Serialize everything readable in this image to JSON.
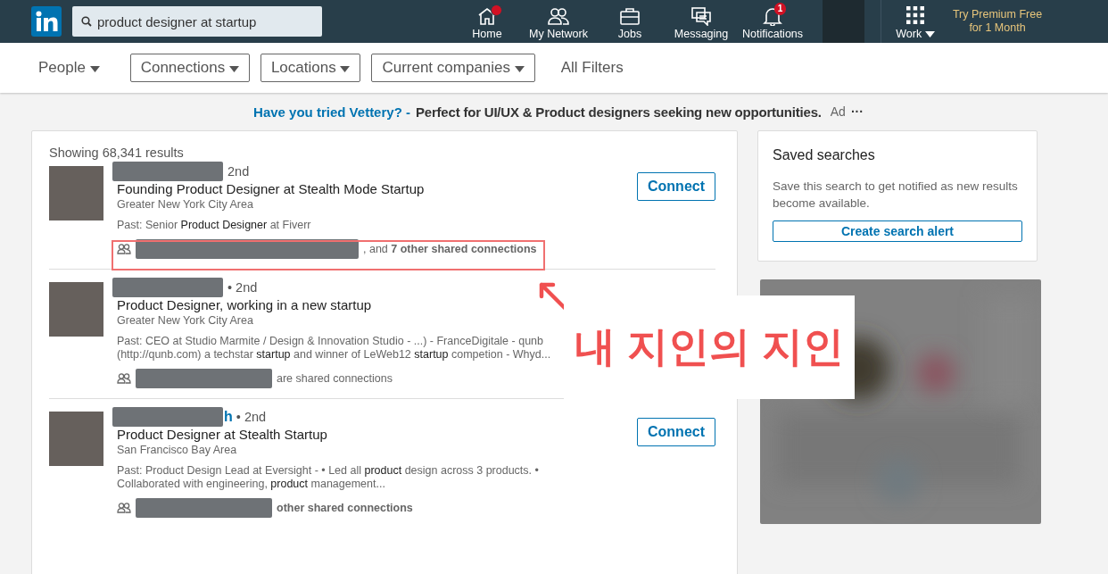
{
  "search": {
    "value": "product designer at startup"
  },
  "nav": [
    {
      "kind": "home",
      "label": "Home",
      "new_dot": true
    },
    {
      "kind": "network",
      "label": "My Network"
    },
    {
      "kind": "jobs",
      "label": "Jobs"
    },
    {
      "kind": "messaging",
      "label": "Messaging"
    },
    {
      "kind": "notifications",
      "label": "Notifications",
      "badge": "1"
    }
  ],
  "work": {
    "label": "Work"
  },
  "premium": {
    "line_1": "Try Premium Free",
    "line_2": "for 1 Month"
  },
  "filters": [
    {
      "kind": "plain",
      "label": "People"
    },
    {
      "kind": "outlined",
      "label": "Connections"
    },
    {
      "kind": "outlined",
      "label": "Locations"
    },
    {
      "kind": "outlined",
      "label": "Current companies"
    },
    {
      "kind": "link",
      "label": "All Filters"
    }
  ],
  "ad": {
    "link": "Have you tried Vettery? -",
    "text": "Perfect for UI/UX & Product designers seeking new opportunities.",
    "tag": "Ad",
    "more": "···"
  },
  "results": {
    "count": "Showing 68,341 results",
    "rows": [
      {
        "degree": "2nd",
        "headline": "Founding Product Designer at Stealth Mode Startup",
        "location": "Greater New York City Area",
        "snippet": "Past: Senior **Product Designer** at Fiverr",
        "shared": ", and **7 other shared connections**",
        "action": "Connect"
      },
      {
        "degree": "• 2nd",
        "headline": "Product Designer, working in a new startup",
        "location": "Greater New York City Area",
        "snippet": "Past: CEO at Studio Marmite / Design & Innovation Studio - ...) - FranceDigitale - qunb (http://qunb.com) a techstar **startup** and winner of LeWeb12 **startup** competion - Whyd...",
        "shared": "are shared connections"
      },
      {
        "name_fragment": "h",
        "degree": "• 2nd",
        "headline": "Product Designer at Stealth Startup",
        "location": "San Francisco Bay Area",
        "snippet": "Past: Product Design Lead at Eversight - • Led all **product** design across 3 products. • Collaborated with engineering, **product** management...",
        "shared": "**other shared connections**",
        "action": "Connect"
      }
    ]
  },
  "saved_searches": {
    "title": "Saved searches",
    "text": "Save this search to get notified as new results become available.",
    "button": "Create search alert"
  },
  "annotation": {
    "label": "내 지인의 지인"
  }
}
